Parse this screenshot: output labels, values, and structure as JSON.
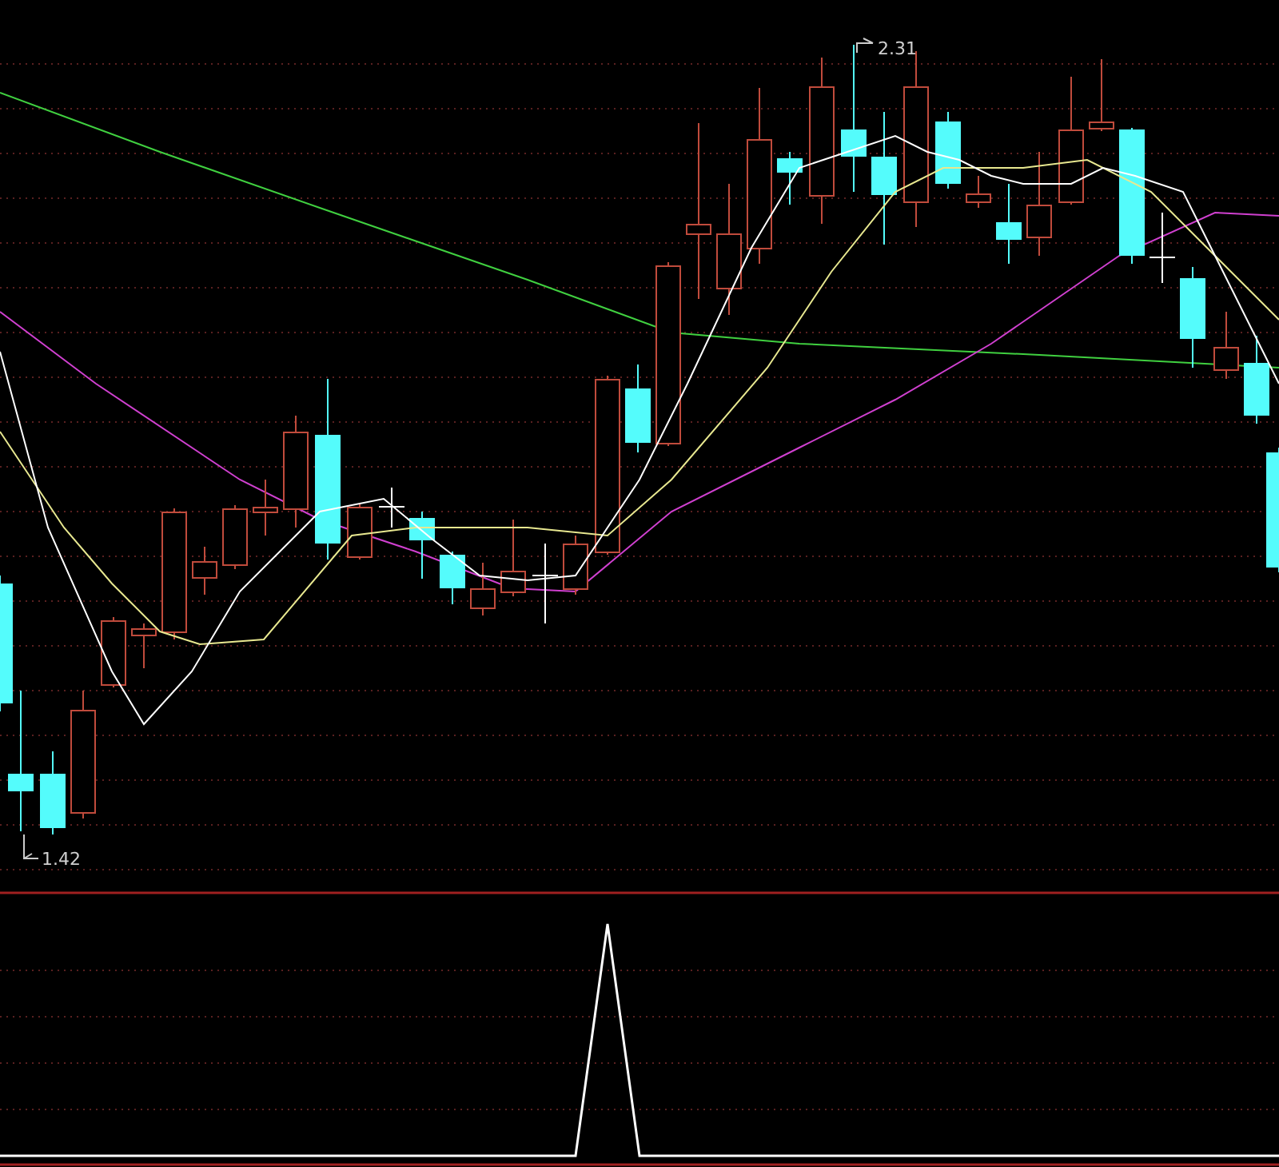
{
  "price_panel": {
    "high_label": "2.31",
    "low_label": "1.42"
  }
}
